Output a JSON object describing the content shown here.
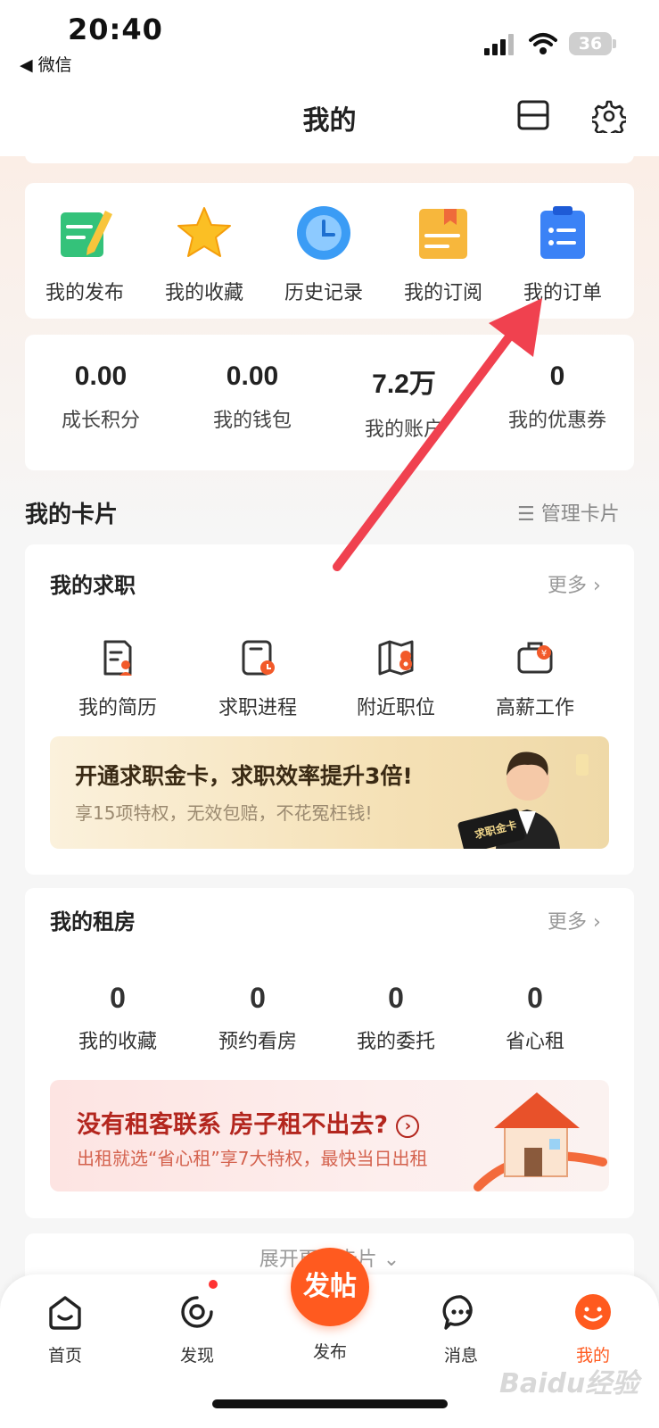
{
  "status_bar": {
    "time": "20:40",
    "back_app": "◀ 微信",
    "battery": "36"
  },
  "header": {
    "title": "我的"
  },
  "shortcuts": [
    {
      "label": "我的发布",
      "icon": "note-pencil-icon"
    },
    {
      "label": "我的收藏",
      "icon": "star-icon"
    },
    {
      "label": "历史记录",
      "icon": "clock-icon"
    },
    {
      "label": "我的订阅",
      "icon": "bookmark-doc-icon"
    },
    {
      "label": "我的订单",
      "icon": "clipboard-list-icon"
    }
  ],
  "stats": [
    {
      "value": "0.00",
      "label": "成长积分"
    },
    {
      "value": "0.00",
      "label": "我的钱包"
    },
    {
      "value": "7.2万",
      "label": "我的账户"
    },
    {
      "value": "0",
      "label": "我的优惠券"
    }
  ],
  "cards_section": {
    "title": "我的卡片",
    "manage": "管理卡片"
  },
  "job_card": {
    "title": "我的求职",
    "more": "更多",
    "items": [
      {
        "label": "我的简历",
        "icon": "resume-icon"
      },
      {
        "label": "求职进程",
        "icon": "progress-icon"
      },
      {
        "label": "附近职位",
        "icon": "map-pin-icon"
      },
      {
        "label": "高薪工作",
        "icon": "briefcase-icon"
      }
    ],
    "banner": {
      "title": "开通求职金卡，求职效率提升3倍!",
      "subtitle": "享15项特权，无效包赔，不花冤枉钱!",
      "badge": "求职金卡"
    }
  },
  "rent_card": {
    "title": "我的租房",
    "more": "更多",
    "items": [
      {
        "value": "0",
        "label": "我的收藏"
      },
      {
        "value": "0",
        "label": "预约看房"
      },
      {
        "value": "0",
        "label": "我的委托"
      },
      {
        "value": "0",
        "label": "省心租"
      }
    ],
    "banner": {
      "title": "没有租客联系 房子租不出去?",
      "subtitle": "出租就选“省心租”享7大特权，最快当日出租"
    }
  },
  "expand": {
    "label": "展开更多卡片"
  },
  "tabbar": {
    "tabs": [
      {
        "label": "首页",
        "icon": "home-icon",
        "active": false
      },
      {
        "label": "发现",
        "icon": "discover-icon",
        "active": false
      },
      {
        "label": "发布",
        "icon": "post-icon",
        "active": false
      },
      {
        "label": "消息",
        "icon": "message-icon",
        "active": false
      },
      {
        "label": "我的",
        "icon": "profile-icon",
        "active": true
      }
    ],
    "post_button": "发帖"
  },
  "watermark": "Baidu经验",
  "colors": {
    "accent": "#ff5a1f",
    "arrow": "#f0414f"
  }
}
